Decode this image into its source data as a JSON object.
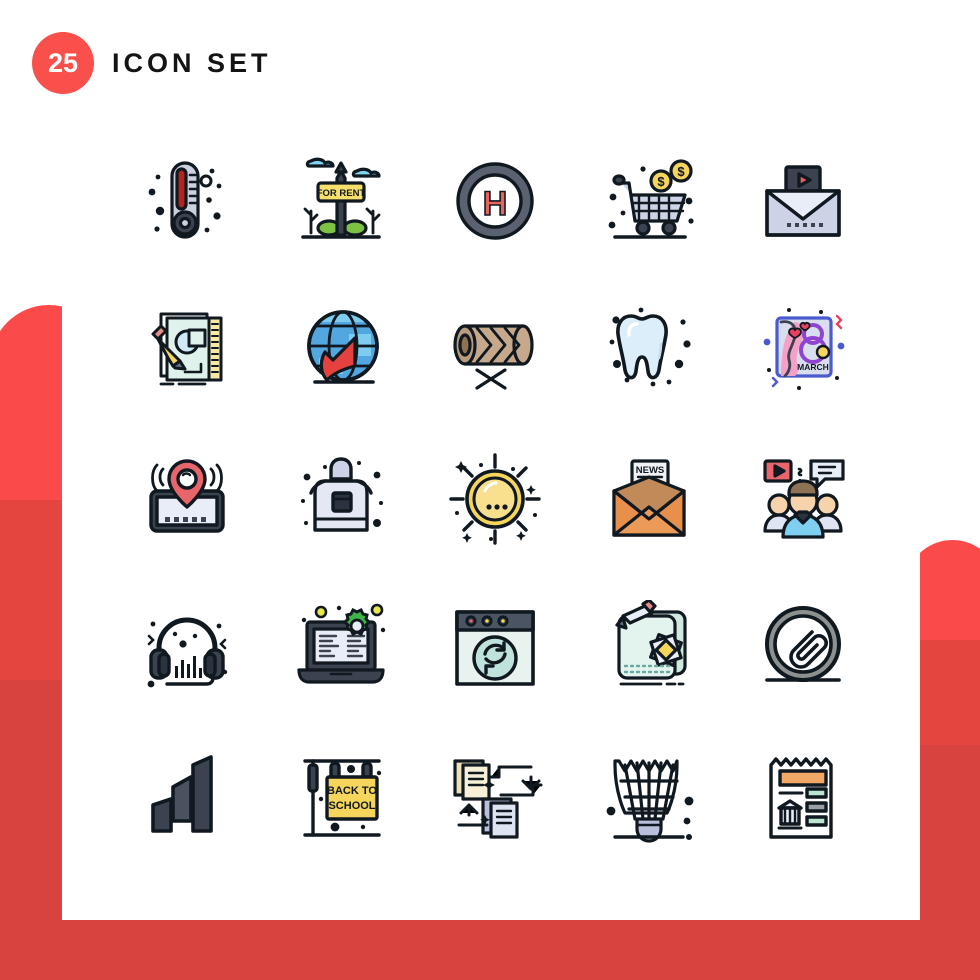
{
  "header": {
    "badge_count": "25",
    "title": "ICON SET",
    "badge_color": "#f9504c",
    "title_color": "#141414"
  },
  "theme": {
    "background": "#ffffff",
    "card_background": "#ffffff",
    "accent_red_light": "#fb4a4a",
    "accent_red_mid": "#e4463f",
    "accent_red_dark": "#d8423f",
    "stroke": "#0e0e0e"
  },
  "grid": {
    "columns": 5,
    "rows": 5,
    "total": 25
  },
  "icons": [
    {
      "index": 1,
      "name": "thermometer-icon",
      "label": "Thermometer",
      "row": 1,
      "col": 1
    },
    {
      "index": 2,
      "name": "for-rent-sign-icon",
      "label": "For Rent Sign",
      "row": 1,
      "col": 2,
      "text": "FOR RENT"
    },
    {
      "index": 3,
      "name": "helipad-h-icon",
      "label": "Helipad",
      "row": 1,
      "col": 3,
      "text": "H"
    },
    {
      "index": 4,
      "name": "shopping-cart-money-icon",
      "label": "Shopping Cart Money",
      "row": 1,
      "col": 4,
      "text": "$"
    },
    {
      "index": 5,
      "name": "video-mail-icon",
      "label": "Video Mail",
      "row": 1,
      "col": 5
    },
    {
      "index": 6,
      "name": "design-sketch-icon",
      "label": "Design Sketch",
      "row": 2,
      "col": 1
    },
    {
      "index": 7,
      "name": "globe-arrow-icon",
      "label": "Global Network",
      "row": 2,
      "col": 2
    },
    {
      "index": 8,
      "name": "wood-log-icon",
      "label": "Wood Log",
      "row": 2,
      "col": 3
    },
    {
      "index": 9,
      "name": "tooth-icon",
      "label": "Tooth",
      "row": 2,
      "col": 4
    },
    {
      "index": 10,
      "name": "womens-day-card-icon",
      "label": "8 March Card",
      "row": 2,
      "col": 5,
      "text": "MARCH"
    },
    {
      "index": 11,
      "name": "location-tracker-icon",
      "label": "Location Tracker",
      "row": 3,
      "col": 1
    },
    {
      "index": 12,
      "name": "apron-icon",
      "label": "Apron",
      "row": 3,
      "col": 2
    },
    {
      "index": 13,
      "name": "sun-icon",
      "label": "Sun",
      "row": 3,
      "col": 3
    },
    {
      "index": 14,
      "name": "newsletter-mail-icon",
      "label": "Newsletter",
      "row": 3,
      "col": 4,
      "text": "NEWS"
    },
    {
      "index": 15,
      "name": "social-team-icon",
      "label": "Social Team",
      "row": 3,
      "col": 5
    },
    {
      "index": 16,
      "name": "headphones-icon",
      "label": "Headphones",
      "row": 4,
      "col": 1
    },
    {
      "index": 17,
      "name": "laptop-settings-icon",
      "label": "Laptop Settings",
      "row": 4,
      "col": 2
    },
    {
      "index": 18,
      "name": "browser-refresh-icon",
      "label": "Browser Refresh",
      "row": 4,
      "col": 3
    },
    {
      "index": 19,
      "name": "graphic-design-icon",
      "label": "Graphic Design",
      "row": 4,
      "col": 4
    },
    {
      "index": 20,
      "name": "attachment-circle-icon",
      "label": "Attachment",
      "row": 4,
      "col": 5
    },
    {
      "index": 21,
      "name": "growth-chart-icon",
      "label": "Growth Chart",
      "row": 5,
      "col": 1
    },
    {
      "index": 22,
      "name": "back-to-school-sign-icon",
      "label": "Back To School",
      "row": 5,
      "col": 2,
      "text": "BACK TO SCHOOL"
    },
    {
      "index": 23,
      "name": "file-transfer-icon",
      "label": "File Transfer",
      "row": 5,
      "col": 3
    },
    {
      "index": 24,
      "name": "shuttlecock-icon",
      "label": "Shuttlecock",
      "row": 5,
      "col": 4
    },
    {
      "index": 25,
      "name": "bank-statement-icon",
      "label": "Bank Statement",
      "row": 5,
      "col": 5
    }
  ],
  "icon_texts": {
    "for_rent": "FOR RENT",
    "helipad": "H",
    "dollar": "$",
    "march": "MARCH",
    "march_number": "8",
    "news": "NEWS",
    "back_to": "BACK TO",
    "school": "SCHOOL"
  }
}
